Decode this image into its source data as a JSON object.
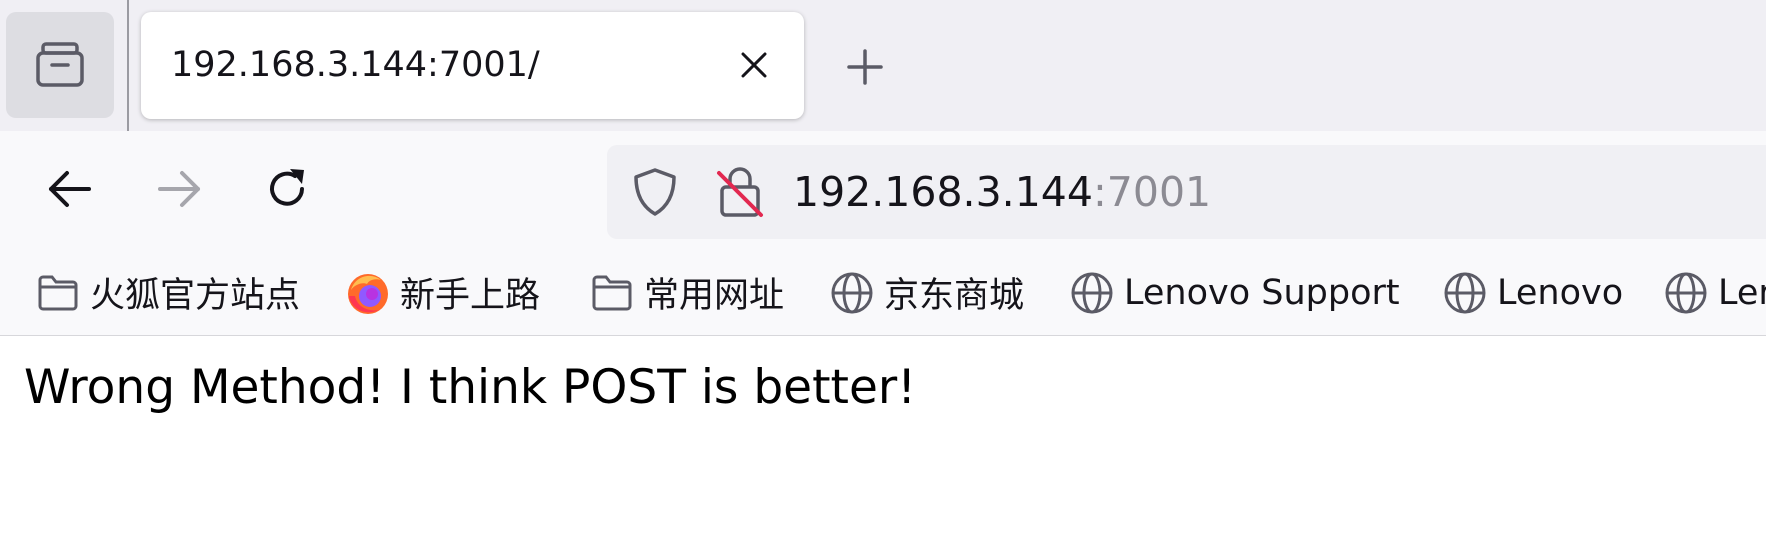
{
  "tab": {
    "title": "192.168.3.144:7001/"
  },
  "urlbar": {
    "host": "192.168.3.144",
    "port": ":7001"
  },
  "bookmarks": [
    {
      "label": "火狐官方站点",
      "icon": "folder-icon"
    },
    {
      "label": "新手上路",
      "icon": "firefox-icon"
    },
    {
      "label": "常用网址",
      "icon": "folder-icon"
    },
    {
      "label": "京东商城",
      "icon": "globe-icon"
    },
    {
      "label": "Lenovo Support",
      "icon": "globe-icon"
    },
    {
      "label": "Lenovo",
      "icon": "globe-icon"
    },
    {
      "label": "Ler",
      "icon": "globe-icon"
    }
  ],
  "page": {
    "message": "Wrong Method! I think POST is better!"
  },
  "colors": {
    "tabstrip_bg": "#f0eff4",
    "toolbar_bg": "#f9f9fb",
    "urlbar_bg": "#f0f0f4",
    "text": "#15141a",
    "muted_text": "#8c8b93",
    "insecure_slash": "#e22850"
  }
}
